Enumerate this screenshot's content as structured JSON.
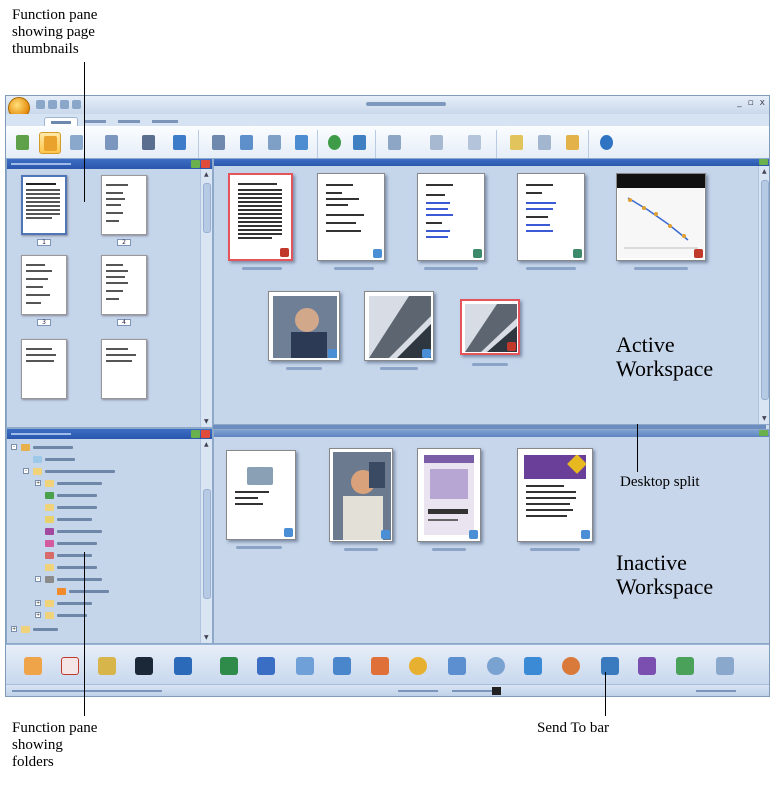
{
  "callouts": {
    "function_pane_pages": "Function pane\nshowing page\nthumbnails",
    "active_workspace": "Active\nWorkspace",
    "desktop_split": "Desktop split",
    "inactive_workspace": "Inactive\nWorkspace",
    "function_pane_folders": "Function pane\nshowing\nfolders",
    "send_to_bar": "Send To bar"
  },
  "window": {
    "controls": [
      "_",
      "▫",
      "x"
    ]
  },
  "thumbnails": {
    "page_numbers": [
      "1",
      "2",
      "3",
      "4"
    ]
  },
  "colors": {
    "pane_header": "#2a57ac",
    "workspace_bg": "#c5d5ea",
    "selection": "#e3555b",
    "ribbon_highlight": "#ffc74a"
  },
  "send_to_icons": [
    "image-editor-icon",
    "pdf-icon",
    "paint-icon",
    "photo-viewer-icon",
    "photoshop-icon",
    "excel-icon",
    "word-icon",
    "notepad-icon",
    "publisher-icon",
    "powerpoint-icon",
    "paint-palette-icon",
    "ocr-icon",
    "scan-icon",
    "magnifier-icon",
    "gallery-icon",
    "sharepoint-icon",
    "chart-icon",
    "recycle-icon",
    "printer-icon"
  ]
}
